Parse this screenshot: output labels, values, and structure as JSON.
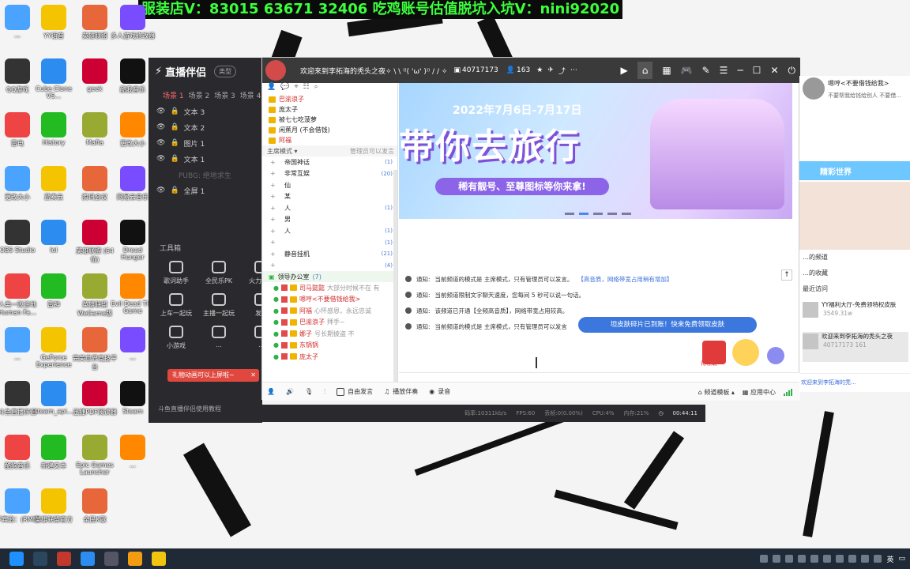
{
  "banner": {
    "text": "服装店V：83015 63671 32406  吃鸡账号估值脱坑入坑V：nini92020"
  },
  "desktop_icons": [
    {
      "label": "…"
    },
    {
      "label": "YY语音"
    },
    {
      "label": "英雄联盟"
    },
    {
      "label": "多人游戏修改器"
    },
    {
      "label": "QQ游戏"
    },
    {
      "label": "Cube Clone VS…"
    },
    {
      "label": "geek"
    },
    {
      "label": "酷我音乐"
    },
    {
      "label": "雷电"
    },
    {
      "label": "History"
    },
    {
      "label": "Mafia"
    },
    {
      "label": "更改大小"
    },
    {
      "label": "更改大小"
    },
    {
      "label": "蓝奏云"
    },
    {
      "label": "腾讯会议"
    },
    {
      "label": "网易云音乐"
    },
    {
      "label": "OBS Studio"
    },
    {
      "label": "lol"
    },
    {
      "label": "英雄联盟 (64位)"
    },
    {
      "label": "Dread Hunger"
    },
    {
      "label": "人类一败涂地 Human Fa…"
    },
    {
      "label": "雷神"
    },
    {
      "label": "英雄联盟 WeGame版"
    },
    {
      "label": "Evil Dead The Game"
    },
    {
      "label": "…"
    },
    {
      "label": "GeForce Experience"
    },
    {
      "label": "完美世界竞技平台"
    },
    {
      "label": "…"
    },
    {
      "label": "斗鱼直播伴侣"
    },
    {
      "label": "steam_api…"
    },
    {
      "label": "迅捷PDF阅读器"
    },
    {
      "label": "Steam"
    },
    {
      "label": "酷狗音乐"
    },
    {
      "label": "新建文本"
    },
    {
      "label": "Epic Games Launcher"
    },
    {
      "label": "…"
    },
    {
      "label": "罗宾逊：(RME)"
    },
    {
      "label": "英雄联盟官方"
    },
    {
      "label": "全民K歌"
    }
  ],
  "obs": {
    "app_title": "直播伴侣",
    "type_label": "类型",
    "scenes": [
      "场景 1",
      "场景 2",
      "场景 3",
      "场景 4"
    ],
    "sources": [
      {
        "label": "文本 3"
      },
      {
        "label": "文本 2"
      },
      {
        "label": "图片 1"
      },
      {
        "label": "文本 1"
      },
      {
        "label": "PUBG: 绝地求生"
      },
      {
        "label": "全屏 1"
      }
    ],
    "toolbox_title": "工具箱",
    "tools": [
      {
        "label": "歌词助手"
      },
      {
        "label": "全民乐PK"
      },
      {
        "label": "火力全开"
      },
      {
        "label": "上车一起玩"
      },
      {
        "label": "主播一起玩"
      },
      {
        "label": "发货"
      },
      {
        "label": "小游戏"
      },
      {
        "label": "…"
      },
      {
        "label": "…"
      }
    ],
    "gift_tip": "礼物动画可以上屏啦~",
    "footer": "斗鱼直播伴侣使用教程"
  },
  "status": {
    "bitrate": "码率:10311kb/s",
    "fps": "FPS:60",
    "dropped": "丢帧:0(0.00%)",
    "cpu": "CPU:4%",
    "mem": "内存:21%",
    "time": "00:44:11"
  },
  "yy": {
    "channel_title": "欢迎来到李拓海的秃头之夜✧ \\ \\ ⁽⁽( 'ω' )⁾⁾ / / ✧",
    "channel_id": "40717173",
    "online_count": "163",
    "top_users": [
      {
        "name": "巴渝浪子"
      },
      {
        "name": "庞太子"
      },
      {
        "name": "被七七吃菠萝"
      },
      {
        "name": "闲蕉月 (不会借钱)"
      },
      {
        "name": "阿福"
      }
    ],
    "mode_label": "主席模式",
    "permission_note": "管理员可以发言",
    "tree": [
      {
        "name": "帝国神话",
        "count": "(1)"
      },
      {
        "name": "非常互娱",
        "count": "(20)"
      },
      {
        "name": "仙",
        "count": ""
      },
      {
        "name": "某",
        "count": ""
      },
      {
        "name": "人",
        "count": "(1)"
      },
      {
        "name": "男",
        "count": ""
      },
      {
        "name": "人",
        "count": "(1)"
      },
      {
        "name": "",
        "count": "(1)"
      },
      {
        "name": "静音挂机",
        "count": "(21)"
      },
      {
        "name": "",
        "count": "(4)"
      }
    ],
    "room": {
      "name": "领导办公室",
      "count": "(7)"
    },
    "members": [
      {
        "name": "司马懿懿",
        "msg": "大部分时候不在 有"
      },
      {
        "name": "嗯哼<不要借钱给我>",
        "msg": ""
      },
      {
        "name": "阿福",
        "msg": "心怀感恩，永远忠诚"
      },
      {
        "name": "巴渝浪子",
        "msg": "拜手~"
      },
      {
        "name": "娜子",
        "msg": "号长期披盗 不"
      },
      {
        "name": "东锅锅",
        "msg": ""
      },
      {
        "name": "庞太子",
        "msg": ""
      }
    ],
    "promo": {
      "date": "2022年7月6日-7月17日",
      "headline": "带你去旅行",
      "sub": "稀有靓号、至尊图标等你来拿!"
    },
    "notices": [
      {
        "prefix": "通知:",
        "text": "当前频道的模式是 主席模式，只有管理员可以发言。",
        "link": "【高音质，网络带宽占用稍有增加】"
      },
      {
        "prefix": "通知:",
        "text": "当前频道限制文字聊天速度，您每间 5 秒可以说一句话。",
        "link": ""
      },
      {
        "prefix": "通知:",
        "text": "该频道已开通【全频高音质】，网络带宽占用较高。",
        "link": ""
      },
      {
        "prefix": "通知:",
        "text": "当前频道的模式是 主席模式，只有管理员可以发言",
        "link": ""
      }
    ],
    "toast": "坦皮肤碎片已到账！快来免费领取皮肤",
    "gift_label": "待领取",
    "bottom": {
      "free_speak": "自由发言",
      "music": "播放伴奏",
      "record": "录音",
      "channel_template": "频道模板",
      "app_center": "应用中心"
    }
  },
  "right_panel": {
    "username": "嗯哼<不要借钱给我>",
    "signature": "不要帮我给钱给别人 不要借…",
    "world_label": "精彩世界",
    "lines": [
      "…的频道",
      "…的收藏",
      "最近访问"
    ],
    "items": [
      {
        "title": "YY福利大厅-免费领特权皮肤",
        "sub": "3549.31w"
      },
      {
        "title": "欢迎来到李拓海的秃头之夜",
        "sub": "40717173  161"
      }
    ],
    "bottom_link": "欢迎来到李拓海的秃…"
  },
  "taskbar": {
    "clock": "英",
    "lang": "英"
  }
}
